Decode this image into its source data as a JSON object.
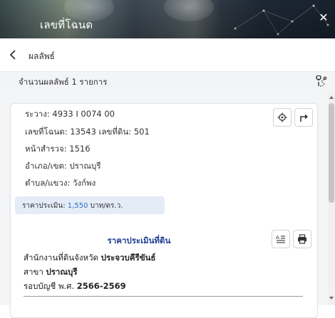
{
  "header": {
    "title": "เลขที่โฉนด",
    "close_icon": "close-icon"
  },
  "nav": {
    "title": "ผลลัพธ์",
    "back_icon": "chevron-left-icon"
  },
  "result_bar": {
    "count_text": "จำนวนผลลัพธ์ 1 รายการ",
    "route_icon": "route-pin-icon"
  },
  "parcel": {
    "ravang_label": "ระวาง:",
    "ravang_value": "4933 I 0074 00",
    "deed_label": "เลขที่โฉนด:",
    "deed_value": "13543",
    "land_no_label": "เลขที่ดิน:",
    "land_no_value": "501",
    "survey_label": "หน้าสำรวจ:",
    "survey_value": "1516",
    "district_label": "อำเภอ/เขต:",
    "district_value": "ปราณบุรี",
    "subdistrict_label": "ตำบล/แขวง:",
    "subdistrict_value": "วังก์พง",
    "price_label": "ราคาประเมิน:",
    "price_value": "1,550",
    "price_unit": "บาท/ตร.ว."
  },
  "appraisal": {
    "title": "ราคาประเมินที่ดิน",
    "office_prefix": "สำนักงานที่ดินจังหวัด",
    "office_value": "ประจวบคีรีขันธ์",
    "branch_prefix": "สาขา",
    "branch_value": "ปราณบุรี",
    "cycle_prefix": "รอบบัญชี พ.ศ.",
    "cycle_value": "2566-2569"
  },
  "colors": {
    "accent": "#2a6fc9",
    "section_title": "#1d3d8f",
    "price_box": "#e4ecf7"
  }
}
